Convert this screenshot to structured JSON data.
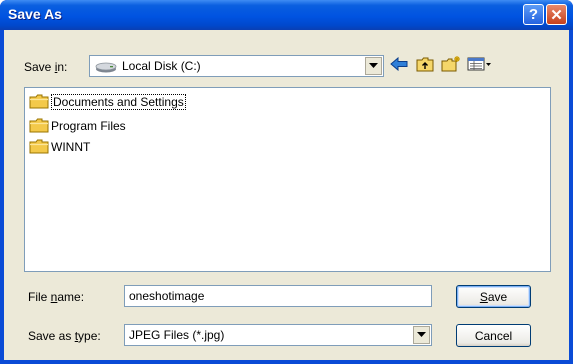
{
  "window": {
    "title": "Save As"
  },
  "titlebar": {
    "help_glyph": "?",
    "close_glyph": "✕"
  },
  "toolbar": {
    "save_in_prefix": "Save ",
    "save_in_underlined": "i",
    "save_in_suffix": "n:",
    "location": "Local Disk (C:)",
    "icons": [
      "back-icon",
      "up-folder-icon",
      "new-folder-icon",
      "view-menu-icon"
    ]
  },
  "files": [
    {
      "name": "Documents and Settings",
      "type": "folder"
    },
    {
      "name": "Program Files",
      "type": "folder"
    },
    {
      "name": "WINNT",
      "type": "folder"
    }
  ],
  "form": {
    "filename_prefix": "File ",
    "filename_underlined": "n",
    "filename_suffix": "ame:",
    "filename_value": "oneshotimage",
    "type_prefix": "Save as ",
    "type_underlined": "t",
    "type_suffix": "ype:",
    "type_value": "JPEG Files (*.jpg)"
  },
  "buttons": {
    "save_underlined": "S",
    "save_rest": "ave",
    "cancel_label": "Cancel"
  },
  "colors": {
    "title_bar": "#0053e1",
    "dialog_bg": "#ece9d8",
    "close": "#c6401c"
  }
}
